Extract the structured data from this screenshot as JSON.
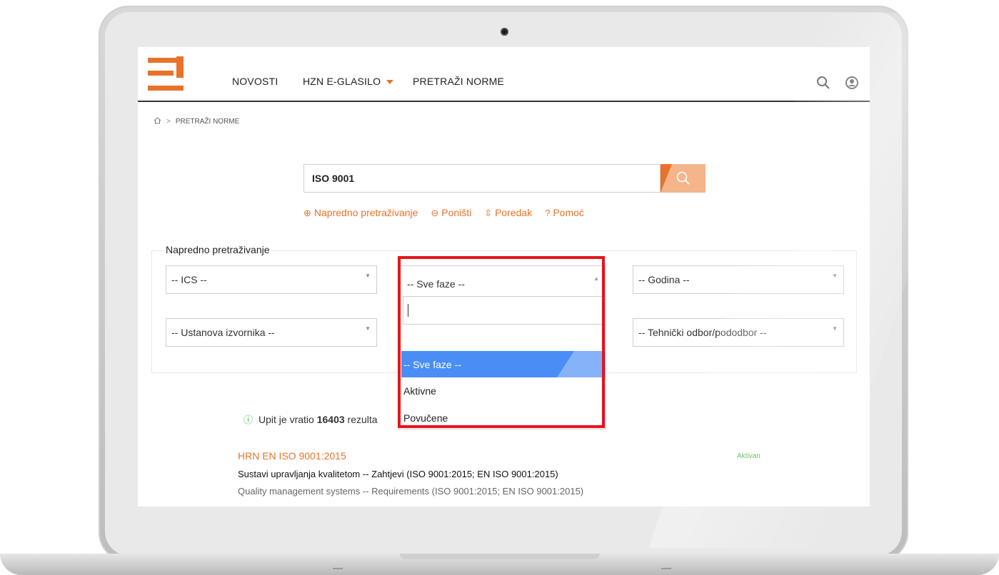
{
  "header": {
    "nav": [
      {
        "label": "NOVOSTI"
      },
      {
        "label": "HZN E-GLASILO"
      },
      {
        "label": "PRETRAŽI NORME"
      }
    ]
  },
  "breadcrumb": {
    "home_icon": "home-icon",
    "separator": ">",
    "current": "PRETRAŽI NORME"
  },
  "search": {
    "value": "ISO 9001",
    "button_icon": "search-icon"
  },
  "links": [
    {
      "icon": "zoom-in-icon",
      "glyph": "⊕",
      "label": "Napredno pretraživanje"
    },
    {
      "icon": "zoom-out-icon",
      "glyph": "⊖",
      "label": "Poništi"
    },
    {
      "icon": "sort-icon",
      "glyph": "⇳",
      "label": "Poredak"
    },
    {
      "icon": "help-icon",
      "glyph": "?",
      "label": "Pomoć"
    }
  ],
  "advanced": {
    "legend": "Napredno pretraživanje",
    "ics": "-- ICS --",
    "phase": "-- Sve faze --",
    "year": "-- Godina --",
    "institution": "-- Ustanova izvornika --",
    "committee": "-- Tehnički odbor/pododbor --"
  },
  "dropdown": {
    "selected": "-- Sve faze --",
    "options": [
      {
        "label": "-- Sve faze --",
        "selected": true
      },
      {
        "label": "Aktivne",
        "selected": false
      },
      {
        "label": "Povučene",
        "selected": false
      }
    ]
  },
  "results": {
    "info_prefix": "Upit je vratio",
    "count": "16403",
    "info_suffix": "rezulta",
    "items": [
      {
        "title": "HRN EN ISO 9001:2015",
        "status": "Aktivan",
        "title_hr": "Sustavi upravljanja kvalitetom -- Zahtjevi (ISO 9001:2015; EN ISO 9001:2015)",
        "title_en": "Quality management systems -- Requirements (ISO 9001:2015; EN ISO 9001:2015)"
      }
    ]
  },
  "colors": {
    "accent": "#e8722a",
    "accent_light": "#f4b58b",
    "selection": "#4a8ef5",
    "highlight": "#e8131b",
    "status_green": "#3aa935"
  }
}
